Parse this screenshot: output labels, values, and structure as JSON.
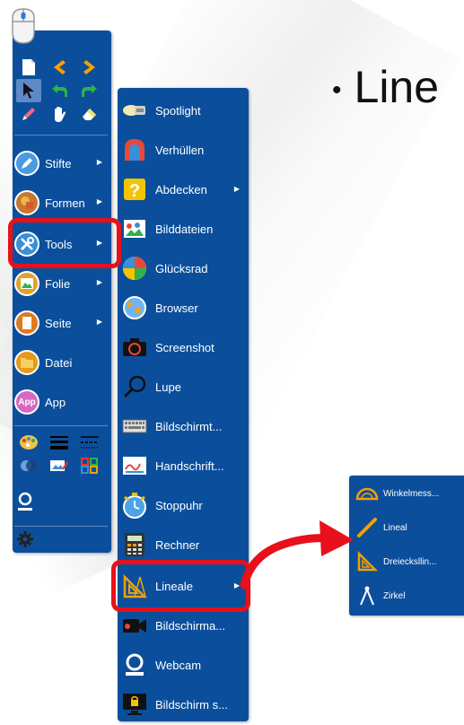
{
  "slide": {
    "title": "Line"
  },
  "main_menu": {
    "items": [
      {
        "label": "Stifte",
        "icon": "pen-color-icon",
        "submenu": true
      },
      {
        "label": "Formen",
        "icon": "shapes-icon",
        "submenu": true
      },
      {
        "label": "Tools",
        "icon": "tools-icon",
        "submenu": true,
        "highlighted": true
      },
      {
        "label": "Folie",
        "icon": "slide-icon",
        "submenu": true
      },
      {
        "label": "Seite",
        "icon": "page-icon",
        "submenu": true
      },
      {
        "label": "Datei",
        "icon": "file-icon",
        "submenu": false
      },
      {
        "label": "App",
        "icon": "app-icon",
        "submenu": false
      }
    ]
  },
  "tools_menu": {
    "items": [
      {
        "label": "Spotlight",
        "icon": "spotlight-icon"
      },
      {
        "label": "Verhüllen",
        "icon": "cover-icon"
      },
      {
        "label": "Abdecken",
        "icon": "question-block-icon",
        "submenu": true
      },
      {
        "label": "Bilddateien",
        "icon": "image-files-icon"
      },
      {
        "label": "Glücksrad",
        "icon": "wheel-of-fortune-icon"
      },
      {
        "label": "Browser",
        "icon": "browser-icon"
      },
      {
        "label": "Screenshot",
        "icon": "camera-icon"
      },
      {
        "label": "Lupe",
        "icon": "magnifier-icon"
      },
      {
        "label": "Bildschirmt...",
        "icon": "keyboard-icon"
      },
      {
        "label": "Handschrift...",
        "icon": "handwriting-icon"
      },
      {
        "label": "Stoppuhr",
        "icon": "stopwatch-icon"
      },
      {
        "label": "Rechner",
        "icon": "calculator-icon"
      },
      {
        "label": "Lineale",
        "icon": "ruler-set-icon",
        "submenu": true,
        "highlighted": true
      },
      {
        "label": "Bildschirma...",
        "icon": "screen-recorder-icon"
      },
      {
        "label": "Webcam",
        "icon": "webcam-icon"
      },
      {
        "label": "Bildschirm s...",
        "icon": "screen-lock-icon"
      }
    ]
  },
  "lineale_menu": {
    "items": [
      {
        "label": "Winkelmess...",
        "icon": "protractor-icon"
      },
      {
        "label": "Lineal",
        "icon": "ruler-icon"
      },
      {
        "label": "Dreiecksllin...",
        "icon": "set-square-icon"
      },
      {
        "label": "Zirkel",
        "icon": "compass-icon"
      }
    ]
  },
  "colors": {
    "panel": "#0b4f9c",
    "highlight": "#e8101a",
    "accent_orange": "#f5a000",
    "accent_green": "#2fb24a"
  }
}
